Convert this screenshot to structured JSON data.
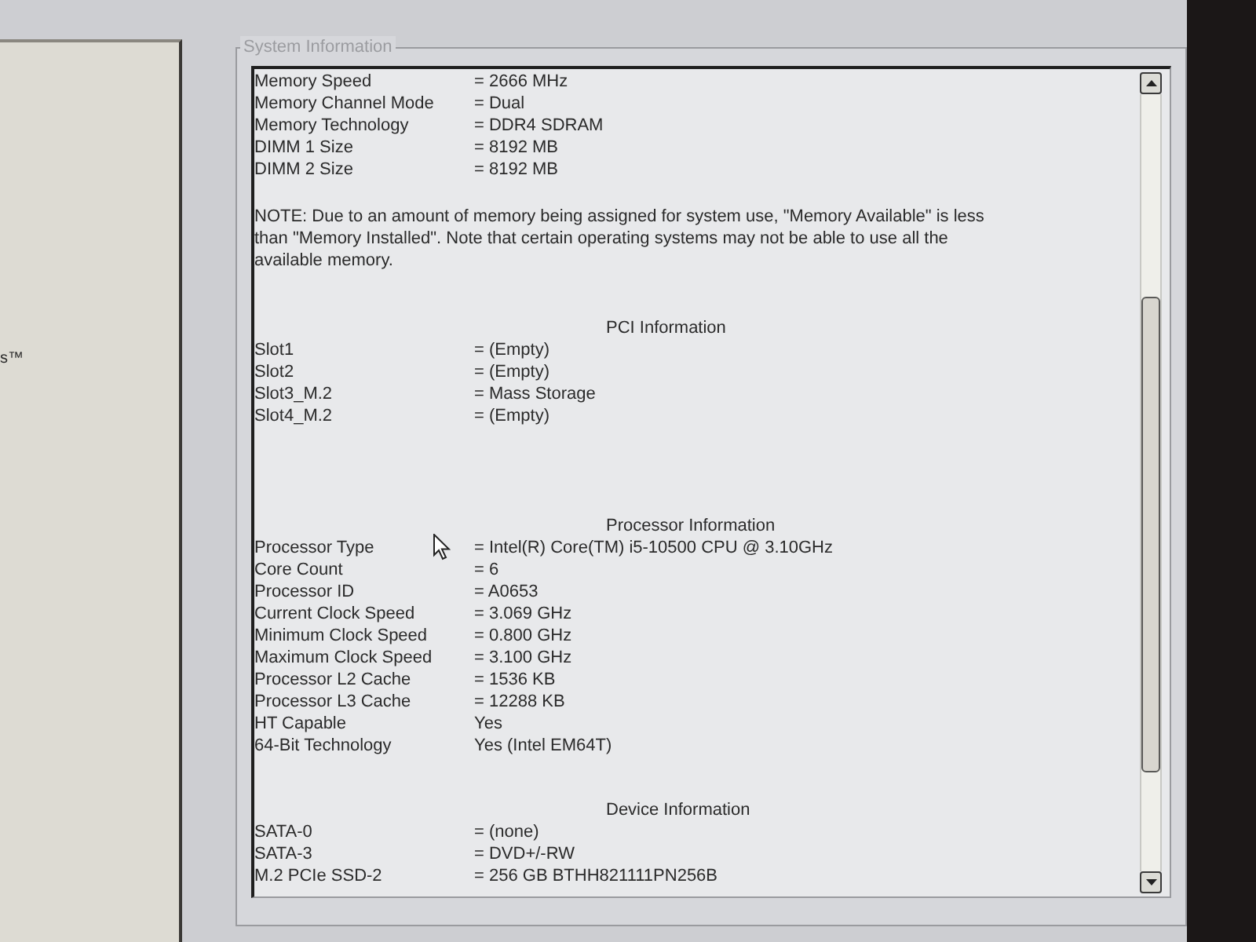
{
  "left_panel": {
    "text": "s™"
  },
  "system_information": {
    "title": "System Information",
    "sections": [
      {
        "rows": [
          {
            "label": "Memory Speed",
            "value": "= 2666 MHz"
          },
          {
            "label": "Memory Channel Mode",
            "value": "= Dual"
          },
          {
            "label": "Memory Technology",
            "value": "= DDR4 SDRAM"
          },
          {
            "label": "DIMM 1 Size",
            "value": "= 8192 MB"
          },
          {
            "label": "DIMM 2 Size",
            "value": "= 8192 MB"
          }
        ],
        "note": "NOTE: Due to an amount of memory being assigned for system use, \"Memory Available\" is less than \"Memory Installed\". Note that certain operating systems may not be able to use all the available memory."
      },
      {
        "heading": "PCI Information",
        "rows": [
          {
            "label": "Slot1",
            "value": "= (Empty)"
          },
          {
            "label": "Slot2",
            "value": "= (Empty)"
          },
          {
            "label": "Slot3_M.2",
            "value": "= Mass Storage"
          },
          {
            "label": "Slot4_M.2",
            "value": "= (Empty)"
          }
        ]
      },
      {
        "heading": "Processor Information",
        "rows": [
          {
            "label": "Processor Type",
            "value": "= Intel(R) Core(TM) i5-10500 CPU @ 3.10GHz"
          },
          {
            "label": "Core Count",
            "value": "= 6"
          },
          {
            "label": "Processor ID",
            "value": "= A0653"
          },
          {
            "label": "Current Clock Speed",
            "value": "= 3.069 GHz"
          },
          {
            "label": "Minimum Clock Speed",
            "value": "= 0.800 GHz"
          },
          {
            "label": "Maximum Clock Speed",
            "value": "= 3.100 GHz"
          },
          {
            "label": "Processor L2 Cache",
            "value": "= 1536 KB"
          },
          {
            "label": "Processor L3 Cache",
            "value": "= 12288 KB"
          },
          {
            "label": "HT Capable",
            "value": "Yes"
          },
          {
            "label": "64-Bit Technology",
            "value": "Yes (Intel EM64T)"
          }
        ]
      },
      {
        "heading": "Device Information",
        "rows": [
          {
            "label": "SATA-0",
            "value": "= (none)"
          },
          {
            "label": "SATA-3",
            "value": "= DVD+/-RW"
          },
          {
            "label": "M.2 PCIe SSD-2",
            "value": "= 256 GB BTHH821111PN256B"
          }
        ]
      }
    ]
  }
}
